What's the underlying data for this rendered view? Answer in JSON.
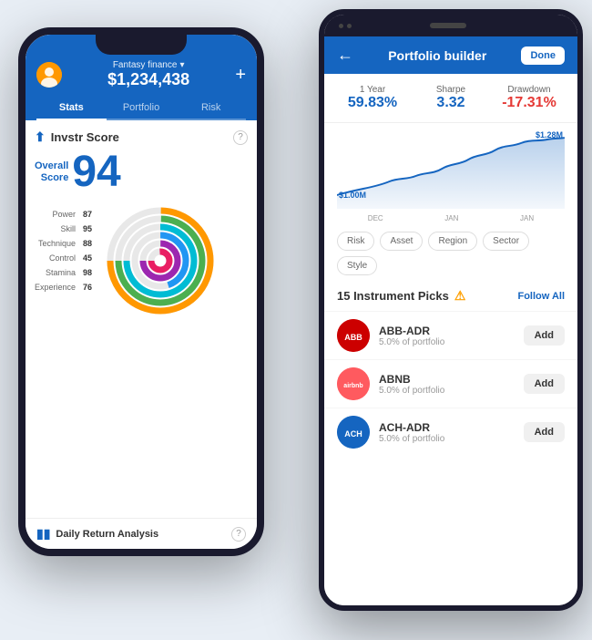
{
  "phone1": {
    "account_name": "Fantasy finance",
    "balance": "$1,234,438",
    "tabs": [
      {
        "label": "Stats",
        "active": true
      },
      {
        "label": "Portfolio",
        "active": false
      },
      {
        "label": "Risk",
        "active": false
      }
    ],
    "invstr_title": "Invstr Score",
    "question": "?",
    "overall_label": "Overall\nScore",
    "overall_score": "94",
    "metrics": [
      {
        "label": "Power",
        "value": "87"
      },
      {
        "label": "Skill",
        "value": "95"
      },
      {
        "label": "Technique",
        "value": "88"
      },
      {
        "label": "Control",
        "value": "45"
      },
      {
        "label": "Stamina",
        "value": "98"
      },
      {
        "label": "Experience",
        "value": "76"
      }
    ],
    "footer_label": "Daily Return Analysis"
  },
  "phone2": {
    "title": "Portfolio builder",
    "done_label": "Done",
    "back_arrow": "←",
    "stats": [
      {
        "label": "1 Year",
        "value": "59.83%",
        "negative": false
      },
      {
        "label": "Sharpe",
        "value": "3.32",
        "negative": false
      },
      {
        "label": "Drawdown",
        "value": "-17.31%",
        "negative": true
      }
    ],
    "chart_labels": [
      "DEC",
      "JAN",
      "JAN"
    ],
    "chart_high_label": "$1.28M",
    "chart_low_label": "$1.00M",
    "filter_tabs": [
      {
        "label": "Risk",
        "active": false
      },
      {
        "label": "Asset",
        "active": false
      },
      {
        "label": "Region",
        "active": false
      },
      {
        "label": "Sector",
        "active": false
      },
      {
        "label": "Style",
        "active": false
      }
    ],
    "picks_count": "15 Instrument Picks",
    "follow_all": "Follow All",
    "instruments": [
      {
        "ticker": "ABB-ADR",
        "short": "ABB",
        "pct": "5.0% of portfolio",
        "bg": "#e53935",
        "color": "#fff"
      },
      {
        "ticker": "ABNB",
        "short": "airbnb",
        "pct": "5.0% of portfolio",
        "bg": "#ff5722",
        "color": "#fff"
      },
      {
        "ticker": "ACH-ADR",
        "short": "ACH",
        "pct": "5.0% of portfolio",
        "bg": "#1565C0",
        "color": "#fff"
      }
    ]
  }
}
